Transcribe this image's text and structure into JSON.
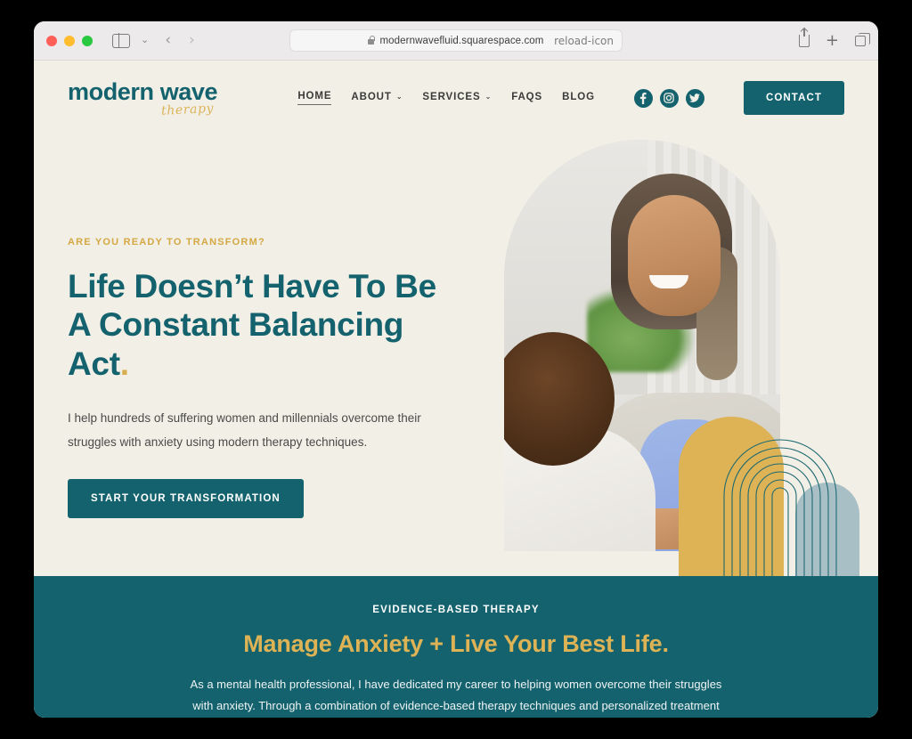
{
  "browser": {
    "url": "modernwavefluid.squarespace.com",
    "lock_icon": "lock-icon",
    "reload_icon": "reload-icon",
    "sidebar_icon": "sidebar-toggle-icon",
    "back_arrow": "‹",
    "forward_arrow": "›",
    "chevron": "⌄",
    "share_icon": "share-icon",
    "new_tab_icon": "+",
    "tab_overview_icon": "tab-overview-icon"
  },
  "site": {
    "logo": {
      "main": "modern wave",
      "sub": "therapy"
    },
    "nav": [
      {
        "label": "HOME",
        "active": true,
        "caret": ""
      },
      {
        "label": "ABOUT",
        "active": false,
        "caret": "⌄"
      },
      {
        "label": "SERVICES",
        "active": false,
        "caret": "⌄"
      },
      {
        "label": "FAQS",
        "active": false,
        "caret": ""
      },
      {
        "label": "BLOG",
        "active": false,
        "caret": ""
      }
    ],
    "socials": [
      {
        "name": "facebook-icon",
        "glyph": "f"
      },
      {
        "name": "instagram-icon",
        "glyph": "◉"
      },
      {
        "name": "twitter-icon",
        "glyph": "t"
      }
    ],
    "contact_label": "CONTACT"
  },
  "hero": {
    "eyebrow": "ARE YOU READY TO TRANSFORM?",
    "title_line1": "Life Doesn’t Have To Be",
    "title_line2": "A Constant Balancing",
    "title_line3": "Act",
    "title_dot": ".",
    "body": "I help hundreds of suffering women and millennials overcome their struggles with anxiety using modern therapy techniques.",
    "cta_label": "START YOUR TRANSFORMATION",
    "image_alt": "therapist-smiling-with-client-photo"
  },
  "band": {
    "eyebrow": "EVIDENCE-BASED THERAPY",
    "title": "Manage Anxiety + Live Your Best Life",
    "title_dot": ".",
    "body": "As a mental health professional, I have dedicated my career to helping women overcome their struggles with anxiety. Through a combination of evidence-based therapy techniques and personalized treatment plans, I have been able to empower hundreds of"
  },
  "colors": {
    "teal": "#13626e",
    "gold": "#ddb355",
    "cream": "#f2efe6",
    "gray_blue": "#a9bfc6"
  }
}
